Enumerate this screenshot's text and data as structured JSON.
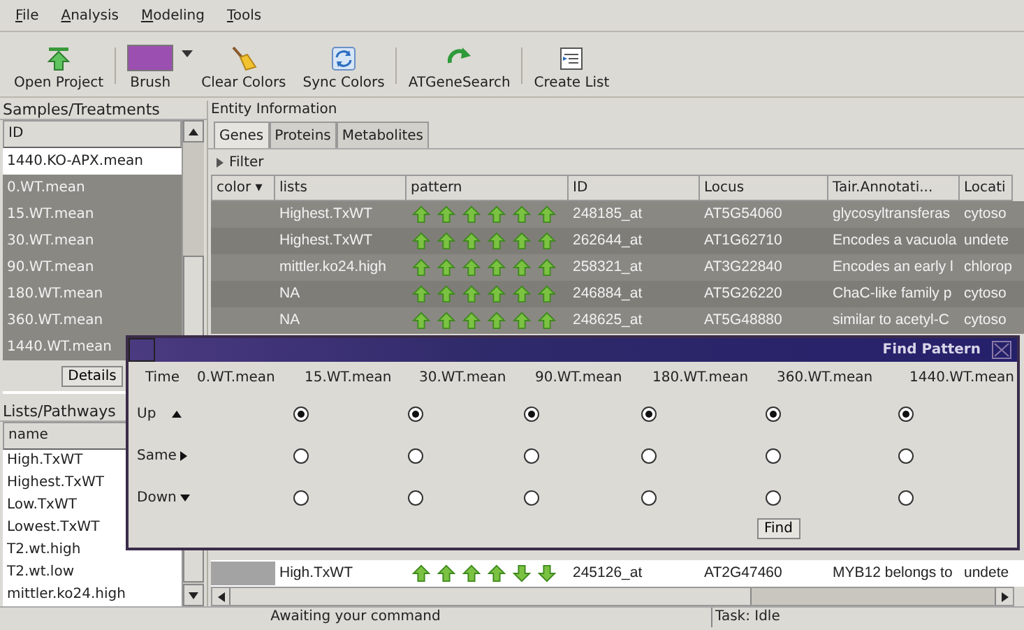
{
  "menu": [
    {
      "label": "File"
    },
    {
      "label": "Analysis"
    },
    {
      "label": "Modeling"
    },
    {
      "label": "Tools"
    }
  ],
  "toolbar": [
    {
      "kind": "open",
      "label": "Open Project"
    },
    {
      "kind": "brush",
      "label": "Brush",
      "color": "#9b4fb0"
    },
    {
      "kind": "clear",
      "label": "Clear Colors"
    },
    {
      "kind": "sync",
      "label": "Sync Colors"
    },
    {
      "kind": "search",
      "label": "ATGeneSearch"
    },
    {
      "kind": "list",
      "label": "Create List"
    }
  ],
  "samples": {
    "title": "Samples/Treatments",
    "column": "ID",
    "button": "Details",
    "items": [
      {
        "label": "1440.KO-APX.mean",
        "selected": false
      },
      {
        "label": "0.WT.mean",
        "selected": true
      },
      {
        "label": "15.WT.mean",
        "selected": true
      },
      {
        "label": "30.WT.mean",
        "selected": true
      },
      {
        "label": "90.WT.mean",
        "selected": true
      },
      {
        "label": "180.WT.mean",
        "selected": true
      },
      {
        "label": "360.WT.mean",
        "selected": true
      },
      {
        "label": "1440.WT.mean",
        "selected": true
      }
    ]
  },
  "lists": {
    "title": "Lists/Pathways",
    "column": "name",
    "items": [
      {
        "label": "High.TxWT"
      },
      {
        "label": "Highest.TxWT"
      },
      {
        "label": "Low.TxWT"
      },
      {
        "label": "Lowest.TxWT"
      },
      {
        "label": "T2.wt.high"
      },
      {
        "label": "T2.wt.low"
      },
      {
        "label": "mittler.ko24.high"
      }
    ]
  },
  "entity": {
    "title": "Entity Information",
    "tabs": [
      {
        "label": "Genes",
        "selected": true
      },
      {
        "label": "Proteins",
        "selected": false
      },
      {
        "label": "Metabolites",
        "selected": false
      }
    ],
    "filter": "Filter",
    "columns": [
      "color ▾",
      "lists",
      "pattern",
      "ID",
      "Locus",
      "Tair.Annotati...",
      "Locati"
    ],
    "rows": [
      {
        "selected": true,
        "lists": "Highest.TxWT",
        "pattern": [
          {
            "kind": "up"
          },
          {
            "kind": "up"
          },
          {
            "kind": "up"
          },
          {
            "kind": "up"
          },
          {
            "kind": "up"
          },
          {
            "kind": "up"
          }
        ],
        "id": "248185_at",
        "locus": "AT5G54060",
        "annotation": "glycosyltransferas",
        "location": "cytoso"
      },
      {
        "selected": true,
        "lists": "Highest.TxWT",
        "pattern": [
          {
            "kind": "up"
          },
          {
            "kind": "up"
          },
          {
            "kind": "up"
          },
          {
            "kind": "up"
          },
          {
            "kind": "up"
          },
          {
            "kind": "up"
          }
        ],
        "id": "262644_at",
        "locus": "AT1G62710",
        "annotation": "Encodes a vacuola",
        "location": "undete"
      },
      {
        "selected": true,
        "lists": "mittler.ko24.high",
        "pattern": [
          {
            "kind": "up"
          },
          {
            "kind": "up"
          },
          {
            "kind": "up"
          },
          {
            "kind": "up"
          },
          {
            "kind": "up"
          },
          {
            "kind": "up"
          }
        ],
        "id": "258321_at",
        "locus": "AT3G22840",
        "annotation": "Encodes an early l",
        "location": "chlorop"
      },
      {
        "selected": true,
        "lists": "NA",
        "pattern": [
          {
            "kind": "up"
          },
          {
            "kind": "up"
          },
          {
            "kind": "up"
          },
          {
            "kind": "up"
          },
          {
            "kind": "up"
          },
          {
            "kind": "up"
          }
        ],
        "id": "246884_at",
        "locus": "AT5G26220",
        "annotation": "ChaC-like family p",
        "location": "cytoso"
      },
      {
        "selected": true,
        "lists": "NA",
        "pattern": [
          {
            "kind": "up"
          },
          {
            "kind": "up"
          },
          {
            "kind": "up"
          },
          {
            "kind": "up"
          },
          {
            "kind": "up"
          },
          {
            "kind": "up"
          }
        ],
        "id": "248625_at",
        "locus": "AT5G48880",
        "annotation": "similar to acetyl-C",
        "location": "cytoso"
      },
      {
        "selected": false,
        "lists": "High.TxWT",
        "pattern": [
          {
            "kind": "up"
          },
          {
            "kind": "up"
          },
          {
            "kind": "up"
          },
          {
            "kind": "up"
          },
          {
            "kind": "down"
          },
          {
            "kind": "down"
          }
        ],
        "id": "245126_at",
        "locus": "AT2G47460",
        "annotation": "MYB12 belongs to",
        "location": "undete"
      }
    ]
  },
  "dialog": {
    "title": "Find Pattern",
    "time_label": "Time",
    "samples": [
      "0.WT.mean",
      "15.WT.mean",
      "30.WT.mean",
      "90.WT.mean",
      "180.WT.mean",
      "360.WT.mean",
      "1440.WT.mean"
    ],
    "rows": [
      {
        "kind": "up",
        "label": "Up",
        "choices": [
          {
            "selected": true
          },
          {
            "selected": true
          },
          {
            "selected": true
          },
          {
            "selected": true
          },
          {
            "selected": true
          },
          {
            "selected": true
          }
        ]
      },
      {
        "kind": "same",
        "label": "Same",
        "choices": [
          {
            "selected": false
          },
          {
            "selected": false
          },
          {
            "selected": false
          },
          {
            "selected": false
          },
          {
            "selected": false
          },
          {
            "selected": false
          }
        ]
      },
      {
        "kind": "down",
        "label": "Down",
        "choices": [
          {
            "selected": false
          },
          {
            "selected": false
          },
          {
            "selected": false
          },
          {
            "selected": false
          },
          {
            "selected": false
          },
          {
            "selected": false
          }
        ]
      }
    ],
    "button": "Find"
  },
  "status": {
    "message": "Awaiting your command",
    "task": "Task: Idle"
  }
}
